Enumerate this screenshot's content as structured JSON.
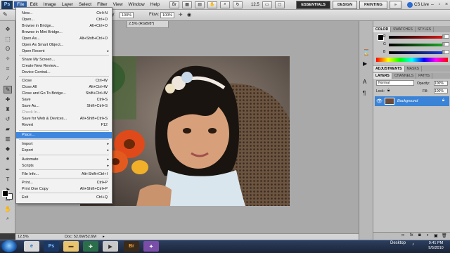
{
  "menubar": {
    "logo": "Ps",
    "menus": [
      "File",
      "Edit",
      "Image",
      "Layer",
      "Select",
      "Filter",
      "View",
      "Window",
      "Help"
    ],
    "zoom": "12.5",
    "workspaces": [
      "ESSENTIALS",
      "DESIGN",
      "PAINTING"
    ],
    "overflow": "»",
    "cs_live": "CS Live",
    "window_buttons": [
      "–",
      "▫",
      "×"
    ]
  },
  "options": {
    "opacity_label": "Opacity:",
    "opacity_value": "100%",
    "flow_label": "Flow:",
    "flow_value": "100%"
  },
  "document": {
    "tab_label": "2.5% (RGB/8*)",
    "zoom_status": "12.5%",
    "doc_info": "Doc: 52.6M/52.6M"
  },
  "file_menu": {
    "items": [
      {
        "label": "New...",
        "shortcut": "Ctrl+N"
      },
      {
        "label": "Open...",
        "shortcut": "Ctrl+O"
      },
      {
        "label": "Browse in Bridge...",
        "shortcut": "Alt+Ctrl+O"
      },
      {
        "label": "Browse in Mini Bridge...",
        "shortcut": ""
      },
      {
        "label": "Open As...",
        "shortcut": "Alt+Shift+Ctrl+O"
      },
      {
        "label": "Open As Smart Object...",
        "shortcut": ""
      },
      {
        "label": "Open Recent",
        "shortcut": "",
        "submenu": true
      },
      {
        "label": "Share My Screen...",
        "shortcut": ""
      },
      {
        "label": "Create New Review...",
        "shortcut": ""
      },
      {
        "label": "Device Central...",
        "shortcut": ""
      },
      {
        "label": "Close",
        "shortcut": "Ctrl+W"
      },
      {
        "label": "Close All",
        "shortcut": "Alt+Ctrl+W"
      },
      {
        "label": "Close and Go To Bridge...",
        "shortcut": "Shift+Ctrl+W"
      },
      {
        "label": "Save",
        "shortcut": "Ctrl+S"
      },
      {
        "label": "Save As...",
        "shortcut": "Shift+Ctrl+S"
      },
      {
        "label": "Check In...",
        "shortcut": "",
        "disabled": true
      },
      {
        "label": "Save for Web & Devices...",
        "shortcut": "Alt+Shift+Ctrl+S"
      },
      {
        "label": "Revert",
        "shortcut": "F12"
      },
      {
        "label": "Place...",
        "shortcut": "",
        "highlighted": true
      },
      {
        "label": "Import",
        "shortcut": "",
        "submenu": true
      },
      {
        "label": "Export",
        "shortcut": "",
        "submenu": true
      },
      {
        "label": "Automate",
        "shortcut": "",
        "submenu": true
      },
      {
        "label": "Scripts",
        "shortcut": "",
        "submenu": true
      },
      {
        "label": "File Info...",
        "shortcut": "Alt+Shift+Ctrl+I"
      },
      {
        "label": "Print...",
        "shortcut": "Ctrl+P"
      },
      {
        "label": "Print One Copy",
        "shortcut": "Alt+Shift+Ctrl+P"
      },
      {
        "label": "Exit",
        "shortcut": "Ctrl+Q"
      }
    ]
  },
  "color_panel": {
    "tabs": [
      "COLOR",
      "SWATCHES",
      "STYLES"
    ],
    "sliders": [
      {
        "label": "R",
        "value": "0",
        "color": "#e01b1b"
      },
      {
        "label": "G",
        "value": "0",
        "color": "#1fae2a"
      },
      {
        "label": "B",
        "value": "0",
        "color": "#1f3fd6"
      }
    ]
  },
  "adjust_panel": {
    "tabs": [
      "ADJUSTMENTS",
      "MASKS"
    ]
  },
  "layers_panel": {
    "tabs": [
      "LAYERS",
      "CHANNELS",
      "PATHS"
    ],
    "blend_mode": "Normal",
    "opacity_label": "Opacity:",
    "opacity_value": "100%",
    "lock_label": "Lock:",
    "fill_label": "Fill:",
    "fill_value": "100%",
    "layer_name": "Background"
  },
  "taskbar": {
    "apps": [
      "Ps",
      "Br"
    ],
    "desktop_label": "Desktop",
    "time": "9:41 PM",
    "date": "9/5/2010"
  },
  "colors": {
    "accent": "#3e86de",
    "dock": "#c4c4c4",
    "workspace": "#a9a9a9"
  }
}
